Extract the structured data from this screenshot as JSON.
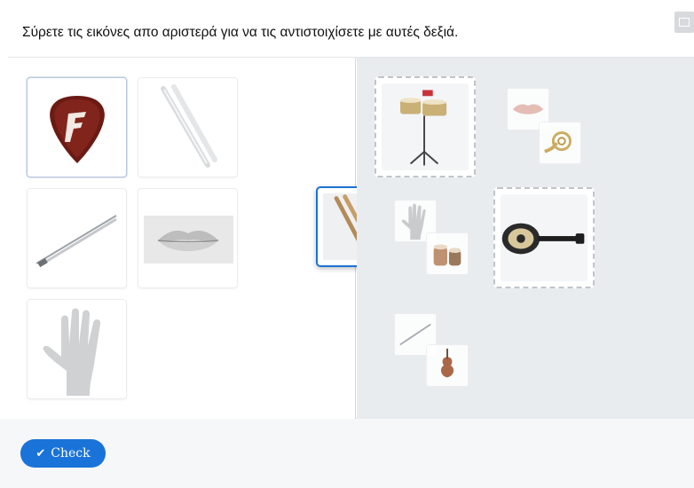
{
  "task": {
    "instruction": "Σύρετε τις εικόνες απο αριστερά για να τις αντιστοιχίσετε με αυτές δεξιά."
  },
  "toolbar": {
    "fullscreen_icon": "fullscreen-icon"
  },
  "draggables": [
    {
      "name": "guitar-pick",
      "selected": true
    },
    {
      "name": "drumsticks-white"
    },
    {
      "name": "violin-bow"
    },
    {
      "name": "lips"
    },
    {
      "name": "hand"
    }
  ],
  "dragging_item": {
    "name": "drumsticks-wooden"
  },
  "dropzones": [
    {
      "name": "timbales",
      "thumbs": [
        "lips",
        "french-horn"
      ]
    },
    {
      "name": "bouzouki",
      "thumbs": [
        "hand",
        "tabla"
      ]
    },
    {
      "name": "empty",
      "thumbs": [
        "violin-bow",
        "violin"
      ]
    }
  ],
  "actions": {
    "check_label": "Check",
    "check_icon": "checkmark-icon"
  },
  "colors": {
    "accent": "#1a73d8",
    "right_pane_bg": "#e9ecef"
  }
}
